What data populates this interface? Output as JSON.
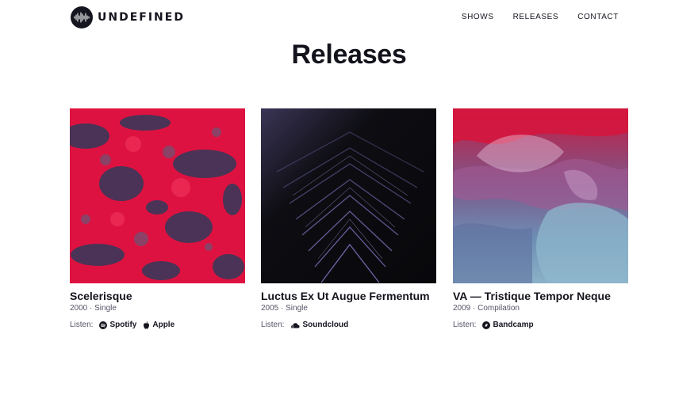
{
  "brand": {
    "name": "UNDEFINED",
    "icon": "waveform-logo-icon"
  },
  "nav": {
    "items": [
      "SHOWS",
      "RELEASES",
      "CONTACT"
    ]
  },
  "page": {
    "title": "Releases"
  },
  "listen_label": "Listen:",
  "releases": [
    {
      "title": "Scelerisque",
      "meta": "2000 · Single",
      "cover_colors": [
        "#de1240",
        "#3e3658"
      ],
      "platforms": [
        {
          "name": "Spotify",
          "icon": "spotify-icon"
        },
        {
          "name": "Apple",
          "icon": "apple-icon"
        }
      ]
    },
    {
      "title": "Luctus Ex Ut Augue Fermentum",
      "meta": "2005 · Single",
      "cover_colors": [
        "#0b0b0f",
        "#7a6fb8"
      ],
      "platforms": [
        {
          "name": "Soundcloud",
          "icon": "soundcloud-icon"
        }
      ]
    },
    {
      "title": "VA — Tristique Tempor Neque",
      "meta": "2009 · Compilation",
      "cover_colors": [
        "#cf1a44",
        "#8bb2c8"
      ],
      "platforms": [
        {
          "name": "Bandcamp",
          "icon": "bandcamp-icon"
        }
      ]
    }
  ],
  "colors": {
    "text": "#13131c",
    "muted": "#555566",
    "background": "#ffffff"
  }
}
